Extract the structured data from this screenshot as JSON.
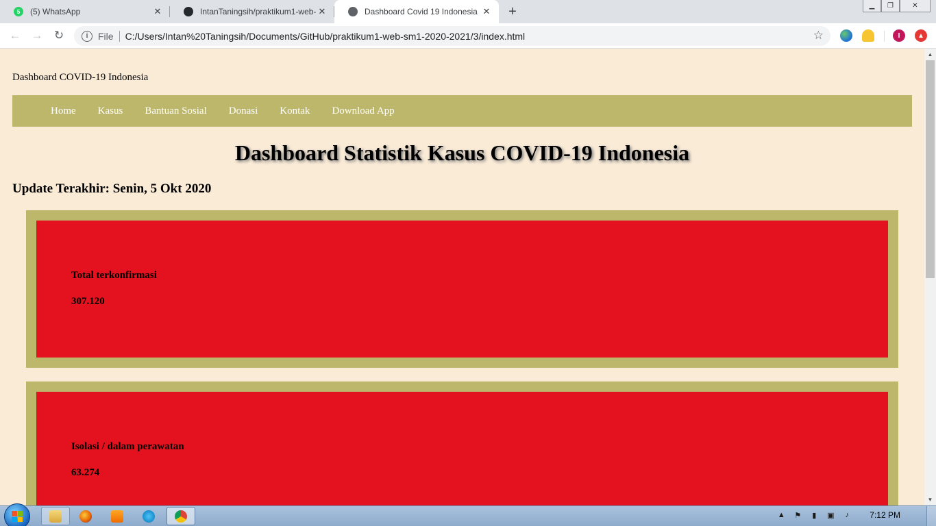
{
  "browser": {
    "tabs": [
      {
        "title": "(5) WhatsApp",
        "favicon": "whatsapp-icon",
        "badge": "5",
        "color": "#25d366"
      },
      {
        "title": "IntanTaningsih/praktikum1-web-",
        "favicon": "github-icon",
        "color": "#24292e"
      },
      {
        "title": "Dashboard Covid 19 Indonesia",
        "favicon": "globe-icon",
        "color": "#5f6368"
      }
    ],
    "address": {
      "scheme_label": "File",
      "url": "C:/Users/Intan%20Taningsih/Documents/GitHub/praktikum1-web-sm1-2020-2021/3/index.html"
    },
    "profile_initial": "I"
  },
  "page": {
    "brand": "Dashboard COVID-19 Indonesia",
    "nav": [
      {
        "label": "Home"
      },
      {
        "label": "Kasus"
      },
      {
        "label": "Bantuan Sosial"
      },
      {
        "label": "Donasi"
      },
      {
        "label": "Kontak"
      },
      {
        "label": "Download App"
      }
    ],
    "title": "Dashboard Statistik Kasus COVID-19 Indonesia",
    "update": "Update Terakhir: Senin, 5 Okt 2020",
    "cards": [
      {
        "label": "Total terkonfirmasi",
        "value": "307.120"
      },
      {
        "label": "Isolasi / dalam perawatan",
        "value": "63.274"
      }
    ],
    "colors": {
      "background": "#faebd7",
      "accent": "#bdb76b",
      "card": "#e3121e"
    }
  },
  "taskbar": {
    "clock": "7:12 PM",
    "apps": [
      "explorer-icon",
      "firefox-icon",
      "media-player-icon",
      "ie-icon",
      "chrome-icon"
    ]
  }
}
